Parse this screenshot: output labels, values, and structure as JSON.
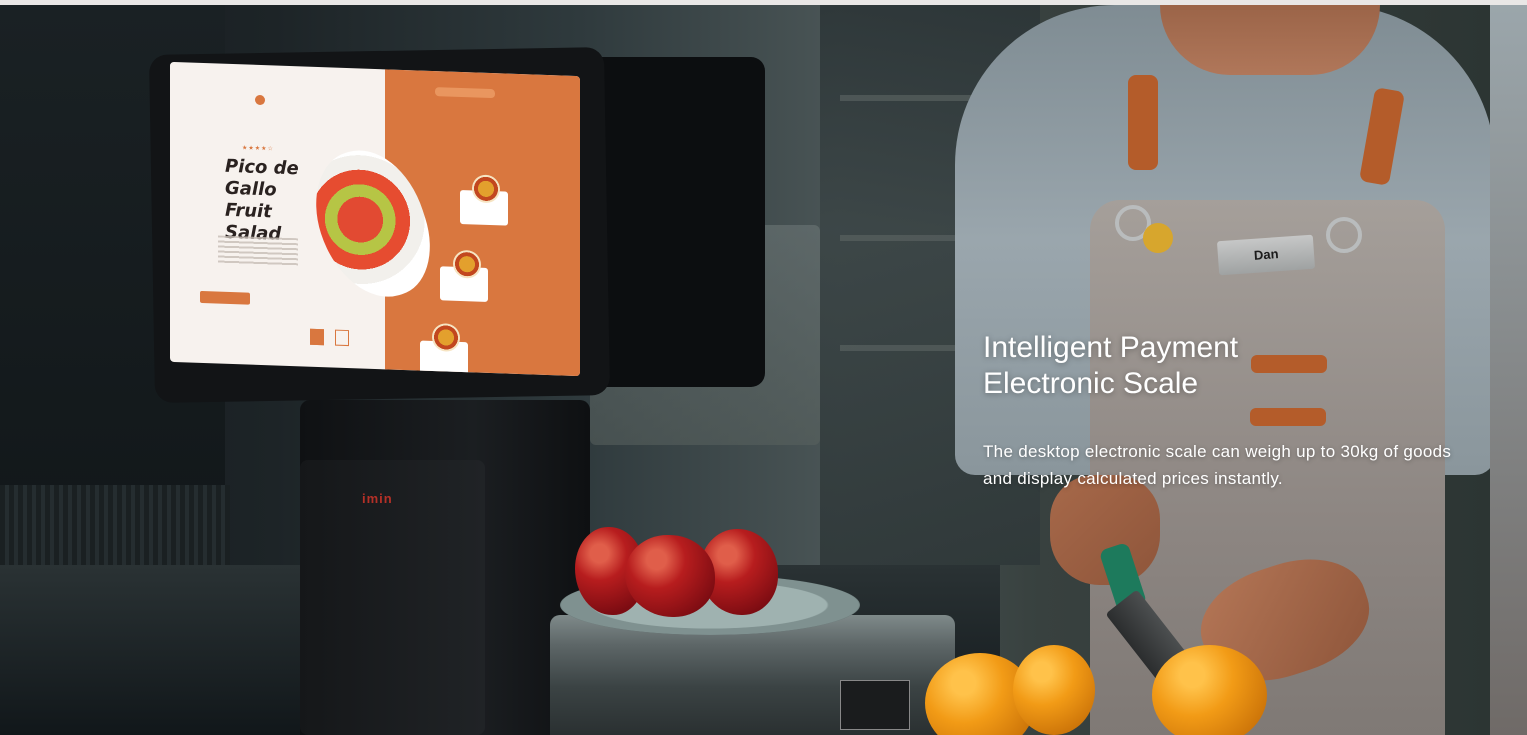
{
  "hero": {
    "headline_line1": "Intelligent Payment",
    "headline_line2": "Electronic Scale",
    "body": "The desktop electronic scale can weigh up to 30kg of goods and display calculated prices instantly."
  },
  "device": {
    "brand": "imin",
    "screen_title": "Pico de Gallo Fruit Salad",
    "rating_stars": "★★★★☆"
  },
  "apron": {
    "name_tag": "Dan"
  },
  "colors": {
    "accent_orange": "#d9773f",
    "headline_text": "#ffffff",
    "brand_red": "#b43027",
    "strap_leather": "#b45c2a"
  }
}
